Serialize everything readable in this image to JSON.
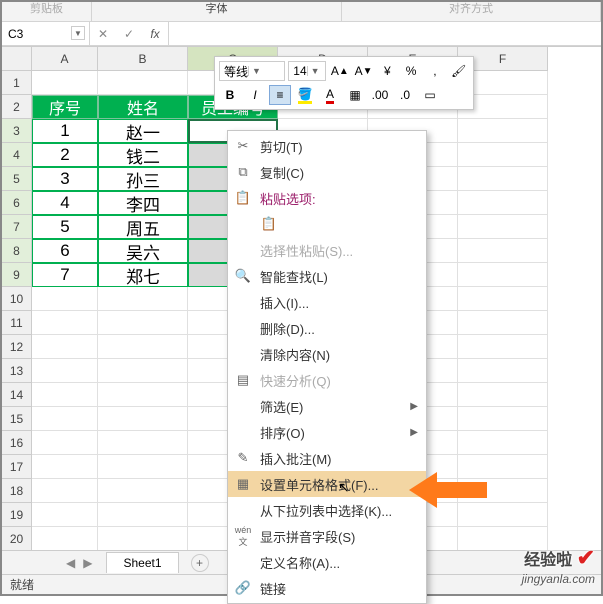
{
  "ribbon_groups": {
    "g1": "剪贴板",
    "g2": "字体",
    "g3": "对齐方式"
  },
  "namebox": "C3",
  "formula_value": "",
  "columns": [
    "A",
    "B",
    "C",
    "D",
    "E",
    "F"
  ],
  "headers": {
    "c1": "序号",
    "c2": "姓名",
    "c3": "员工编号"
  },
  "rows": [
    {
      "n": "1",
      "name": "赵一"
    },
    {
      "n": "2",
      "name": "钱二"
    },
    {
      "n": "3",
      "name": "孙三"
    },
    {
      "n": "4",
      "name": "李四"
    },
    {
      "n": "5",
      "name": "周五"
    },
    {
      "n": "6",
      "name": "吴六"
    },
    {
      "n": "7",
      "name": "郑七"
    }
  ],
  "mini_toolbar": {
    "font": "等线",
    "size": "14",
    "bold": "B",
    "italic": "I",
    "percent": "%",
    "comma": ","
  },
  "context_menu": {
    "cut": "剪切(T)",
    "copy": "复制(C)",
    "paste_options": "粘贴选项:",
    "paste_special": "选择性粘贴(S)...",
    "smart_lookup": "智能查找(L)",
    "insert": "插入(I)...",
    "delete": "删除(D)...",
    "clear": "清除内容(N)",
    "quick_analysis": "快速分析(Q)",
    "filter": "筛选(E)",
    "sort": "排序(O)",
    "insert_comment": "插入批注(M)",
    "format_cells": "设置单元格格式(F)...",
    "pick_from_list": "从下拉列表中选择(K)...",
    "show_pinyin": "显示拼音字段(S)",
    "define_name": "定义名称(A)...",
    "hyperlink": "链接"
  },
  "sheet_tab": "Sheet1",
  "status": "就绪",
  "watermark": {
    "main": "经验啦",
    "sub": "jingyanla.com"
  }
}
